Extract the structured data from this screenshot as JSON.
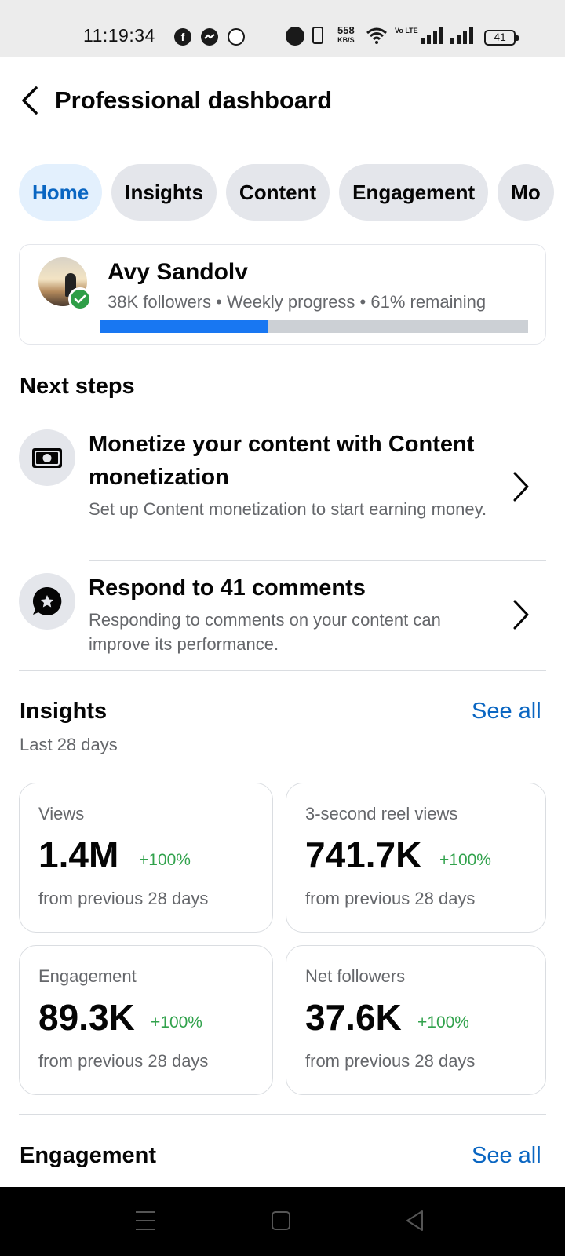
{
  "status_bar": {
    "time": "11:19:34",
    "net_speed": "558",
    "net_speed_unit": "KB/S",
    "lte_label": "Vo LTE",
    "battery": "41",
    "icons": [
      "facebook-icon",
      "messenger-icon",
      "whatsapp-icon",
      "alarm-icon",
      "vibrate-icon",
      "wifi-icon",
      "signal-icon",
      "battery-icon"
    ]
  },
  "header": {
    "title": "Professional dashboard"
  },
  "tabs": [
    {
      "label": "Home",
      "active": true
    },
    {
      "label": "Insights",
      "active": false
    },
    {
      "label": "Content",
      "active": false
    },
    {
      "label": "Engagement",
      "active": false
    },
    {
      "label": "Mo",
      "active": false
    }
  ],
  "profile": {
    "name": "Avy Sandolv",
    "meta": "38K followers • Weekly progress • 61% remaining",
    "weekly_progress_fraction": 0.39
  },
  "next_steps": {
    "title": "Next steps",
    "items": [
      {
        "title": "Monetize your content with Content monetization",
        "description": "Set up Content monetization to start earning money.",
        "icon": "money-icon"
      },
      {
        "title": "Respond to 41 comments",
        "description": "Responding to comments on your content can improve its performance.",
        "icon": "comment-star-icon"
      }
    ]
  },
  "insights": {
    "title": "Insights",
    "see_all": "See all",
    "period": "Last 28 days",
    "cards": [
      {
        "label": "Views",
        "value": "1.4M",
        "change": "+100%",
        "sub": "from previous 28 days"
      },
      {
        "label": "3-second reel views",
        "value": "741.7K",
        "change": "+100%",
        "sub": "from previous 28 days"
      },
      {
        "label": "Engagement",
        "value": "89.3K",
        "change": "+100%",
        "sub": "from previous 28 days"
      },
      {
        "label": "Net followers",
        "value": "37.6K",
        "change": "+100%",
        "sub": "from previous 28 days"
      }
    ]
  },
  "engagement": {
    "title": "Engagement",
    "see_all": "See all"
  },
  "colors": {
    "accent": "#0a66c2",
    "progress": "#1877f2",
    "positive": "#31a24c",
    "secondary_text": "#65676b"
  }
}
